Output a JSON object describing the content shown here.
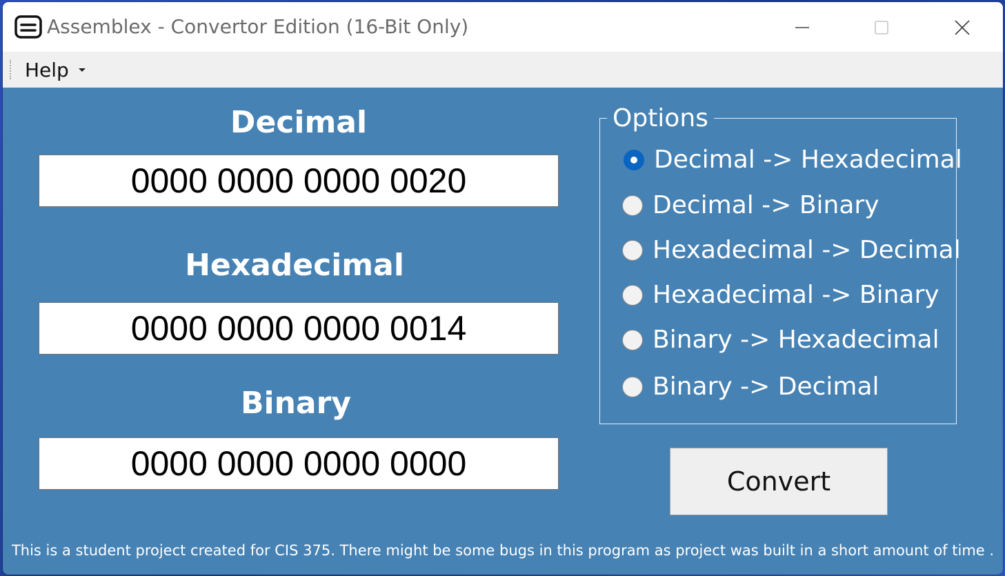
{
  "window": {
    "title": "Assemblex - Convertor Edition (16-Bit Only)",
    "icon": "keyboard-icon",
    "controls": [
      "minimize-icon",
      "maximize-icon",
      "close-icon"
    ]
  },
  "menu": {
    "help_label": "Help"
  },
  "fields": {
    "decimal": {
      "label": "Decimal",
      "value": "0000 0000 0000 0020"
    },
    "hexadecimal": {
      "label": "Hexadecimal",
      "value": "0000 0000 0000 0014"
    },
    "binary": {
      "label": "Binary",
      "value": "0000 0000 0000 0000"
    }
  },
  "options": {
    "legend": "Options",
    "items": [
      {
        "label": "Decimal -> Hexadecimal",
        "checked": true
      },
      {
        "label": "Decimal -> Binary",
        "checked": false
      },
      {
        "label": "Hexadecimal -> Decimal",
        "checked": false
      },
      {
        "label": "Hexadecimal -> Binary",
        "checked": false
      },
      {
        "label": "Binary -> Hexadecimal",
        "checked": false
      },
      {
        "label": "Binary -> Decimal",
        "checked": false
      }
    ]
  },
  "convert_label": "Convert",
  "footer": "This is a student project created for CIS 375. There might be some bugs in this program as project was built in a short amount of time .",
  "colors": {
    "background": "#4682b4",
    "accent": "#0a64c2"
  }
}
